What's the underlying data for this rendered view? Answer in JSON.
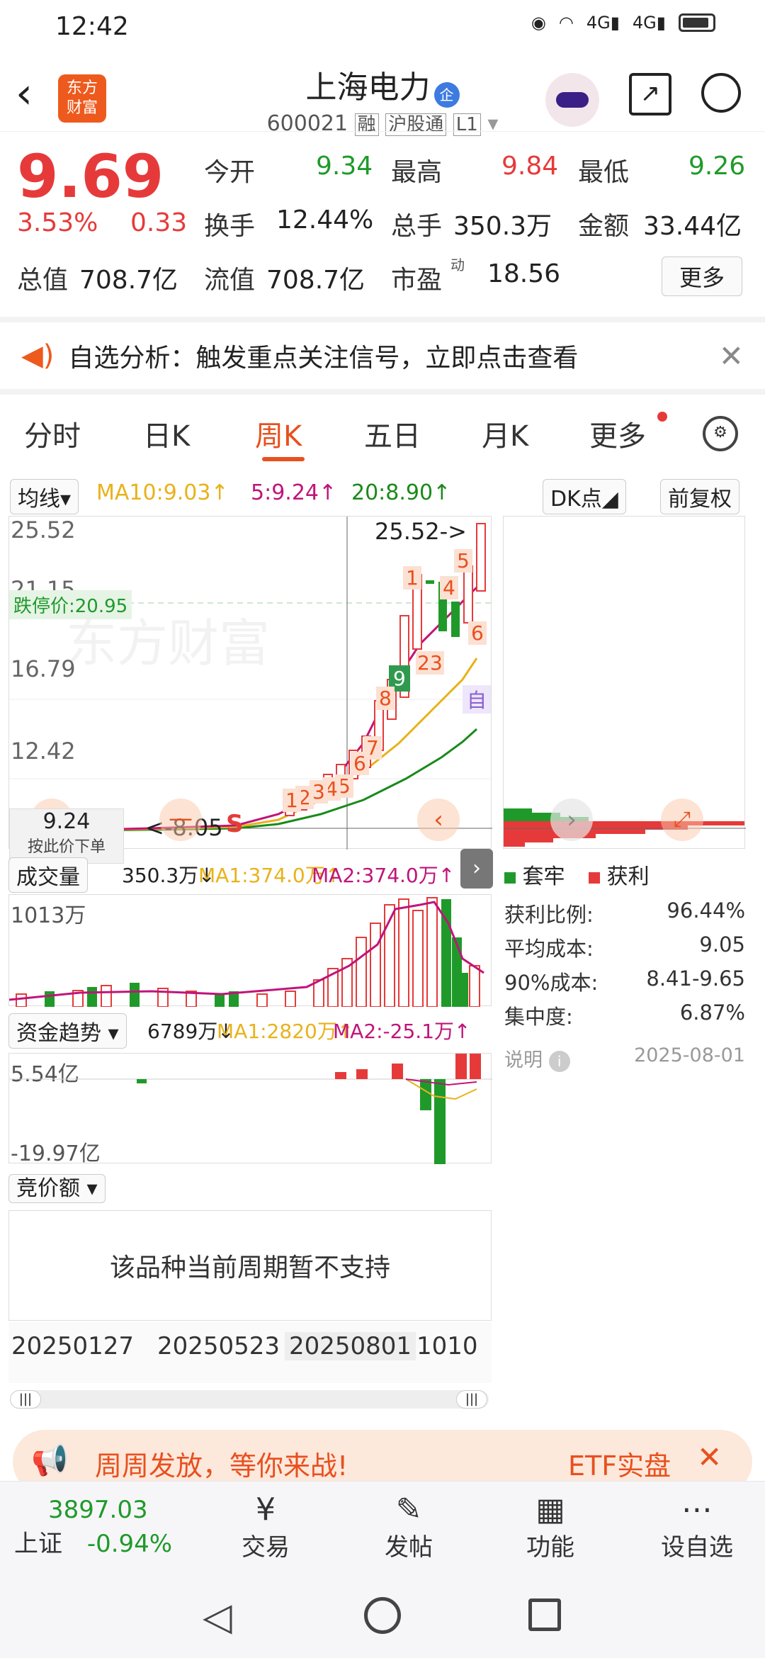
{
  "status": {
    "time": "12:42",
    "sig1": "4G",
    "sig2": "4G"
  },
  "header": {
    "app_logo": "东方\n财富",
    "stock_name": "上海电力",
    "badge": "企",
    "code": "600021",
    "tags": [
      "融",
      "沪股通",
      "L1"
    ]
  },
  "quote": {
    "price": "9.69",
    "change_pct": "3.53%",
    "change": "0.33",
    "open_lbl": "今开",
    "open": "9.34",
    "high_lbl": "最高",
    "high": "9.84",
    "low_lbl": "最低",
    "low": "9.26",
    "turnover_lbl": "换手",
    "turnover": "12.44%",
    "volume_lbl": "总手",
    "volume": "350.3万",
    "amount_lbl": "金额",
    "amount": "33.44亿",
    "mcap_lbl": "总值",
    "mcap": "708.7亿",
    "float_lbl": "流值",
    "float": "708.7亿",
    "pe_lbl": "市盈",
    "pe_sup": "动",
    "pe": "18.56",
    "more": "更多"
  },
  "banner": {
    "text": "自选分析：触发重点关注信号，立即点击查看"
  },
  "tabs": [
    "分时",
    "日K",
    "周K",
    "五日",
    "月K",
    "更多"
  ],
  "active_tab": "周K",
  "ma_bar": {
    "sel": "均线",
    "ma10": "MA10:9.03↑",
    "ma5": "5:9.24↑",
    "ma20": "20:8.90↑",
    "dk": "DK点",
    "fq": "前复权"
  },
  "kline": {
    "y_top": "25.52",
    "y2": "21.15",
    "y3": "16.79",
    "y4": "12.42",
    "limit_label": "跌停价:20.95",
    "high_mark": "25.52->",
    "low_mark": "<-8.05",
    "s_mark": "S",
    "pos_label": "9.24",
    "order_hint": "按此价下单",
    "self": "自",
    "marks": [
      "1",
      "2",
      "3",
      "4",
      "5",
      "6",
      "7",
      "8",
      "9",
      "1",
      "2",
      "3",
      "4",
      "5",
      "6",
      "1",
      "2",
      "3"
    ]
  },
  "vol": {
    "sel": "成交量",
    "val": "350.3万↓",
    "ma1": "MA1:374.0万↑",
    "ma2": "MA2:374.0万↑",
    "ymax": "1013万"
  },
  "fund": {
    "sel": "资金趋势",
    "val": "6789万↓",
    "ma1": "MA1:2820万↑",
    "ma2": "MA2:-25.1万↑",
    "ytop": "5.54亿",
    "ybot": "-19.97亿"
  },
  "auction": {
    "sel": "竞价额",
    "msg": "该品种当前周期暂不支持"
  },
  "xaxis": [
    "20250127",
    "20250523",
    "20250801",
    "1010"
  ],
  "chips": {
    "legend_a": "套牢",
    "legend_b": "获利",
    "rows": [
      [
        "获利比例:",
        "96.44%"
      ],
      [
        "平均成本:",
        "9.05"
      ],
      [
        "90%成本:",
        "8.41-9.65"
      ],
      [
        "集中度:",
        "6.87%"
      ]
    ],
    "note": "说明",
    "date": "2025-08-01"
  },
  "promo": {
    "text": "周周发放，等你来战!",
    "right": "ETF实盘"
  },
  "bottom": {
    "index_val": "3897.03",
    "index_name": "上证",
    "index_chg": "-0.94%",
    "items": [
      "交易",
      "发帖",
      "功能",
      "设自选"
    ]
  },
  "colors": {
    "up": "#e63a3a",
    "down": "#1f9a2a",
    "accent": "#e8501e",
    "ma10": "#e8b21a",
    "ma5": "#c0147a",
    "ma20": "#1a8a1a"
  }
}
